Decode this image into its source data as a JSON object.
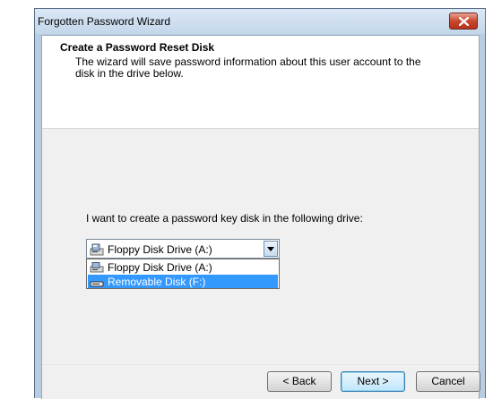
{
  "window": {
    "title": "Forgotten Password Wizard"
  },
  "header": {
    "title": "Create a Password Reset Disk",
    "subtitle": "The wizard will save password information about this user account to the disk in the drive below."
  },
  "body": {
    "prompt": "I want to create a password key disk in the following drive:",
    "combo_value": "Floppy Disk Drive (A:)",
    "options": [
      {
        "label": "Floppy Disk Drive (A:)",
        "icon": "floppy-drive-icon",
        "selected": false
      },
      {
        "label": "Removable Disk (F:)",
        "icon": "removable-disk-icon",
        "selected": true
      }
    ]
  },
  "buttons": {
    "back": "< Back",
    "next": "Next >",
    "cancel": "Cancel"
  },
  "colors": {
    "selection": "#3399ff",
    "close_button": "#c8472f"
  }
}
